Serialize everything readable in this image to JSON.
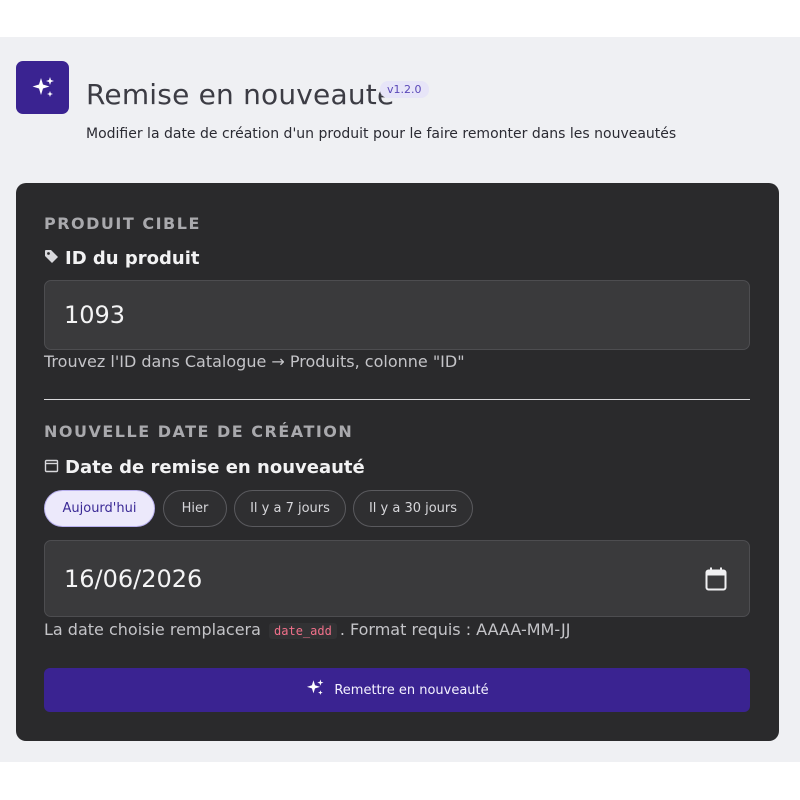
{
  "header": {
    "icon": "sparkles-icon",
    "title": "Remise en nouveauté",
    "version": "v1.2.0",
    "subtitle": "Modifier la date de création d'un produit pour le faire remonter dans les nouveautés"
  },
  "product": {
    "section_label": "Produit cible",
    "field_icon": "tag-icon",
    "field_label": "ID du produit",
    "value": "1093",
    "hint": "Trouvez l'ID dans Catalogue → Produits, colonne \"ID\""
  },
  "date": {
    "section_label": "Nouvelle date de création",
    "field_icon": "calendar-icon",
    "field_label": "Date de remise en nouveauté",
    "presets": [
      {
        "label": "Aujourd'hui",
        "active": true
      },
      {
        "label": "Hier",
        "active": false
      },
      {
        "label": "Il y a 7 jours",
        "active": false
      },
      {
        "label": "Il y a 30 jours",
        "active": false
      }
    ],
    "value": "16/06/2026",
    "picker_icon": "calendar-icon",
    "hint_prefix": "La date choisie remplacera",
    "hint_code": "date_add",
    "hint_suffix": ". Format requis : AAAA-MM-JJ"
  },
  "submit": {
    "icon": "sparkles-icon",
    "label": "Remettre en nouveauté"
  },
  "colors": {
    "accent": "#3a2391",
    "card": "#2a2a2c",
    "page": "#eff0f3",
    "code": "#f0708a"
  }
}
